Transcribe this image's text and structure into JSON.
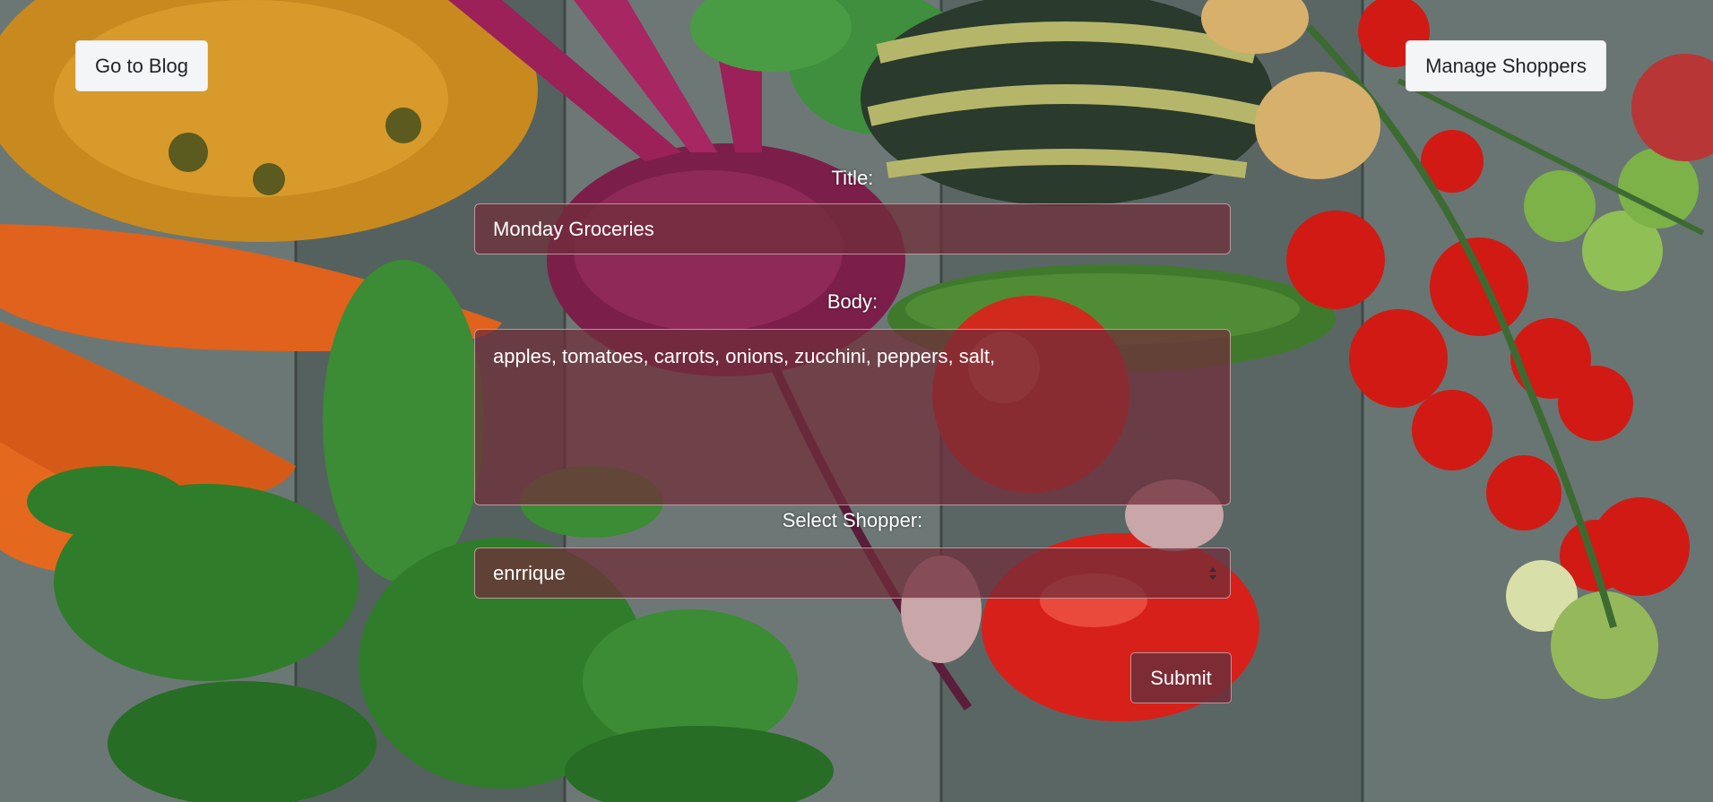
{
  "nav": {
    "blog_label": "Go to Blog",
    "shoppers_label": "Manage Shoppers"
  },
  "form": {
    "title_label": "Title:",
    "title_value": "Monday Groceries",
    "body_label": "Body:",
    "body_value": "apples, tomatoes, carrots, onions, zucchini, peppers, salt,",
    "shopper_label": "Select Shopper:",
    "shopper_value": "enrrique",
    "submit_label": "Submit"
  },
  "colors": {
    "field_bg": "#702e3a",
    "button_bg": "#f4f5f6"
  },
  "icons": {
    "select_caret": "sort-arrows-icon"
  }
}
